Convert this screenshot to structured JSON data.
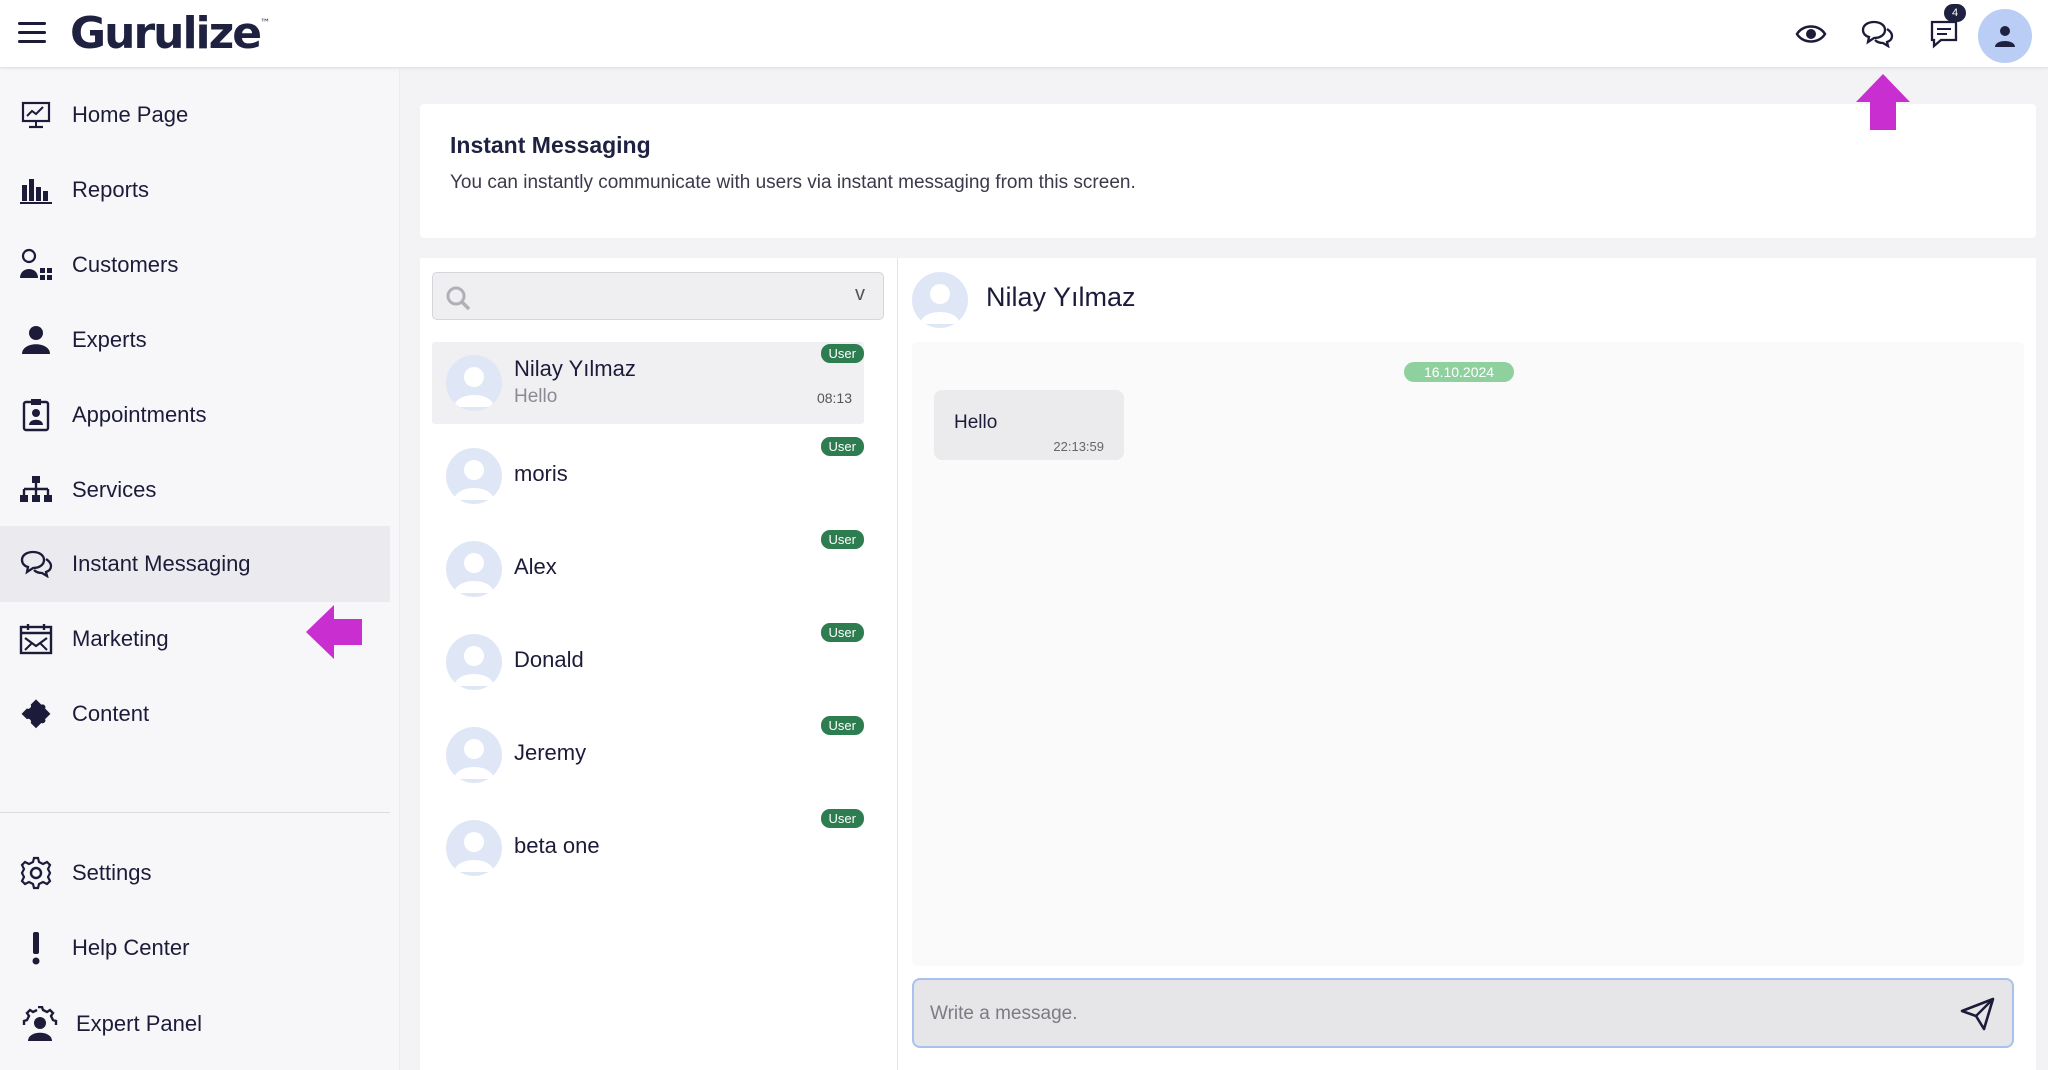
{
  "app": {
    "logo": "Gurulize",
    "logo_mark": "™"
  },
  "topbar": {
    "icons": [
      "eye-icon",
      "chat-bubbles-icon",
      "message-icon",
      "user-avatar-icon"
    ],
    "notification_count": "4"
  },
  "sidebar": {
    "items": [
      {
        "label": "Home Page",
        "icon": "monitor-chart-icon"
      },
      {
        "label": "Reports",
        "icon": "bar-chart-icon"
      },
      {
        "label": "Customers",
        "icon": "customers-icon"
      },
      {
        "label": "Experts",
        "icon": "expert-icon"
      },
      {
        "label": "Appointments",
        "icon": "clipboard-user-icon"
      },
      {
        "label": "Services",
        "icon": "sitemap-icon"
      },
      {
        "label": "Instant Messaging",
        "icon": "chat-bubbles-icon"
      },
      {
        "label": "Marketing",
        "icon": "mail-calendar-icon"
      },
      {
        "label": "Content",
        "icon": "puzzle-icon"
      }
    ],
    "bottom_items": [
      {
        "label": "Settings",
        "icon": "gear-icon"
      },
      {
        "label": "Help Center",
        "icon": "exclamation-icon"
      },
      {
        "label": "Expert Panel",
        "icon": "user-gear-icon"
      }
    ],
    "active": "Instant Messaging"
  },
  "header": {
    "title": "Instant Messaging",
    "subtitle": "You can instantly communicate with users via instant messaging from this screen."
  },
  "search": {
    "value": "",
    "placeholder": "",
    "toggle": "v"
  },
  "contacts": [
    {
      "name": "Nilay Yılmaz",
      "preview": "Hello",
      "badge": "User",
      "time": "08:13"
    },
    {
      "name": "moris",
      "preview": "",
      "badge": "User",
      "time": ""
    },
    {
      "name": "Alex",
      "preview": "",
      "badge": "User",
      "time": ""
    },
    {
      "name": "Donald",
      "preview": "",
      "badge": "User",
      "time": ""
    },
    {
      "name": "Jeremy",
      "preview": "",
      "badge": "User",
      "time": ""
    },
    {
      "name": "beta one",
      "preview": "",
      "badge": "User",
      "time": ""
    }
  ],
  "conversation": {
    "contact_name": "Nilay Yılmaz",
    "date": "16.10.2024",
    "messages": [
      {
        "text": "Hello",
        "time": "22:13:59"
      }
    ],
    "compose_placeholder": "Write a message."
  },
  "colors": {
    "brand": "#1e2240",
    "user_badge": "#2e7d50",
    "date_pill": "#8fd19e",
    "annotation_arrow": "#c92fd0",
    "avatar_bg": "#b9cdf5"
  }
}
